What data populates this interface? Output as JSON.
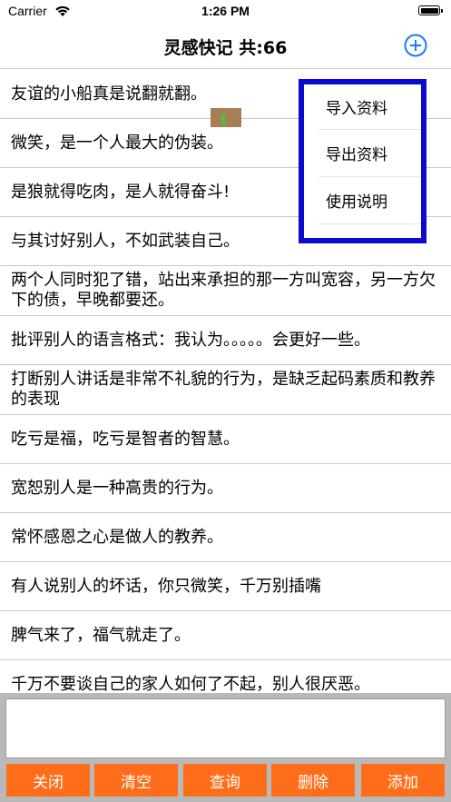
{
  "status_bar": {
    "carrier": "Carrier",
    "time": "1:26 PM"
  },
  "nav": {
    "title": "灵感快记  共:66",
    "add_icon": "plus-circle-icon",
    "accent_color": "#1a7cf5"
  },
  "items": [
    {
      "text": "友谊的小船真是说翻就翻。"
    },
    {
      "text": "微笑，是一个人最大的伪装。"
    },
    {
      "text": "是狼就得吃肉，是人就得奋斗!"
    },
    {
      "text": "与其讨好别人，不如武装自己。"
    },
    {
      "text": "两个人同时犯了错，站出来承担的那一方叫宽容，另一方欠下的债，早晚都要还。"
    },
    {
      "text": "批评别人的语言格式：我认为。。。。。会更好一些。"
    },
    {
      "text": "打断别人讲话是非常不礼貌的行为，是缺乏起码素质和教养的表现"
    },
    {
      "text": "吃亏是福，吃亏是智者的智慧。"
    },
    {
      "text": "宽恕别人是一种高贵的行为。"
    },
    {
      "text": "常怀感恩之心是做人的教养。"
    },
    {
      "text": "有人说别人的坏话，你只微笑，千万别插嘴"
    },
    {
      "text": "脾气来了，福气就走了。"
    },
    {
      "text": "千万不要谈自己的家人如何了不起，别人很厌恶。"
    }
  ],
  "menu": {
    "items": [
      "导入资料",
      "导出资料",
      "使用说明"
    ],
    "border_color": "#0b0bcf"
  },
  "input": {
    "value": ""
  },
  "buttons": {
    "close": "关闭",
    "clear": "清空",
    "query": "查询",
    "delete": "删除",
    "add": "添加",
    "color": "#ff6d1a"
  }
}
